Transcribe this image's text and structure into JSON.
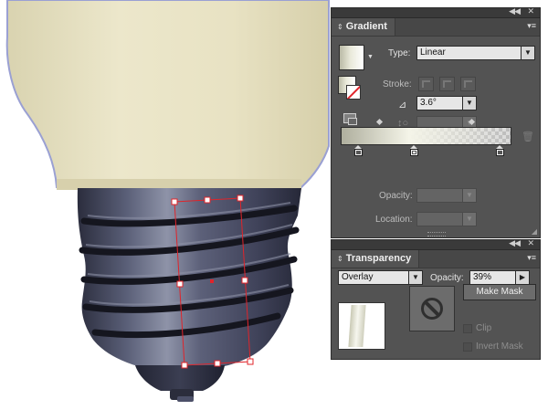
{
  "gradient_panel": {
    "tab_title": "Gradient",
    "type_label": "Type:",
    "type_value": "Linear",
    "stroke_label": "Stroke:",
    "angle_value": "3.6°",
    "opacity_label": "Opacity:",
    "location_label": "Location:",
    "stops_count": 3
  },
  "transparency_panel": {
    "tab_title": "Transparency",
    "blend_mode": "Overlay",
    "opacity_label": "Opacity:",
    "opacity_value": "39%",
    "make_mask_label": "Make Mask",
    "clip_label": "Clip",
    "invert_mask_label": "Invert Mask"
  },
  "colors": {
    "panel_bg": "#535353",
    "bulb_glass": "#e7e2c4",
    "bulb_outline": "#9a9fcf",
    "base_metal": "#3c3f52",
    "selection": "#e0242a"
  },
  "icons": [
    "panel-menu-icon",
    "collapse-icon",
    "close-icon",
    "angle-icon",
    "aspect-ratio-icon",
    "trash-icon",
    "no-mask-icon",
    "link-icon",
    "reverse-gradient-icon"
  ]
}
